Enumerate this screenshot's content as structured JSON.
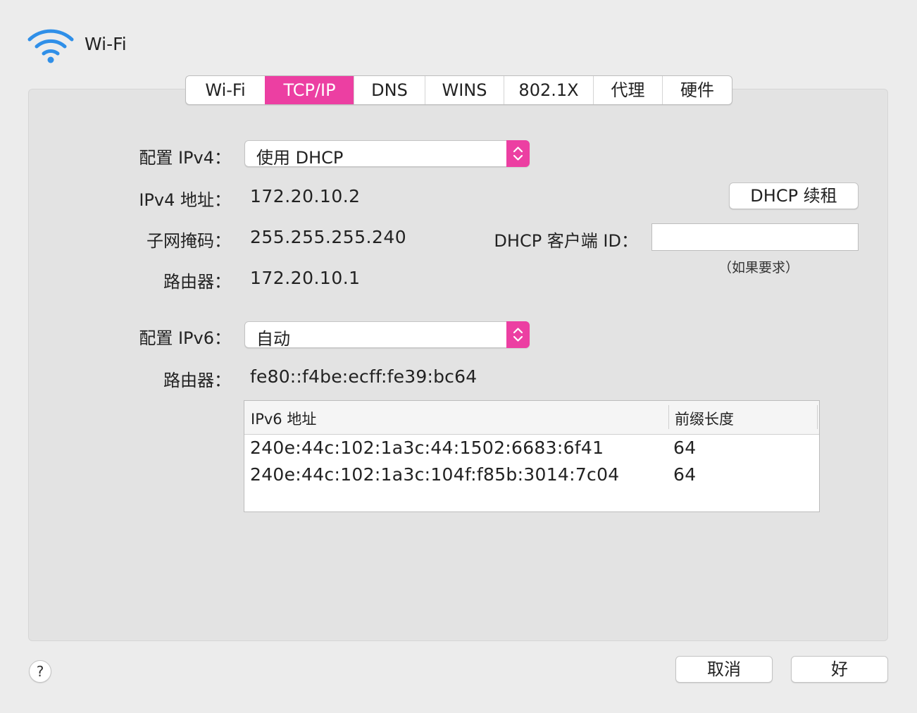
{
  "window": {
    "title": "Wi-Fi"
  },
  "tabs": [
    {
      "label": "Wi-Fi",
      "active": false
    },
    {
      "label": "TCP/IP",
      "active": true
    },
    {
      "label": "DNS",
      "active": false
    },
    {
      "label": "WINS",
      "active": false
    },
    {
      "label": "802.1X",
      "active": false
    },
    {
      "label": "代理",
      "active": false
    },
    {
      "label": "硬件",
      "active": false
    }
  ],
  "ipv4": {
    "configure_label": "配置 IPv4：",
    "configure_value": "使用 DHCP",
    "address_label": "IPv4 地址：",
    "address_value": "172.20.10.2",
    "subnet_label": "子网掩码：",
    "subnet_value": "255.255.255.240",
    "router_label": "路由器：",
    "router_value": "172.20.10.1",
    "renew_button": "DHCP 续租",
    "client_id_label": "DHCP 客户端 ID：",
    "client_id_value": "",
    "client_id_hint": "（如果要求）"
  },
  "ipv6": {
    "configure_label": "配置 IPv6：",
    "configure_value": "自动",
    "router_label": "路由器：",
    "router_value": "fe80::f4be:ecff:fe39:bc64",
    "table": {
      "headers": [
        "IPv6 地址",
        "前缀长度"
      ],
      "rows": [
        {
          "address": "240e:44c:102:1a3c:44:1502:6683:6f41",
          "prefix": "64"
        },
        {
          "address": "240e:44c:102:1a3c:104f:f85b:3014:7c04",
          "prefix": "64"
        }
      ]
    }
  },
  "footer": {
    "help_label": "?",
    "cancel_label": "取消",
    "ok_label": "好"
  },
  "colors": {
    "accent": "#ec3fa2",
    "wifi_icon": "#2f8fe8",
    "background": "#ececec",
    "panel": "#e3e3e3"
  },
  "icons": {
    "wifi": "wifi-icon",
    "popup_stepper": "up-down-chevron-icon",
    "help": "question-mark-icon"
  }
}
